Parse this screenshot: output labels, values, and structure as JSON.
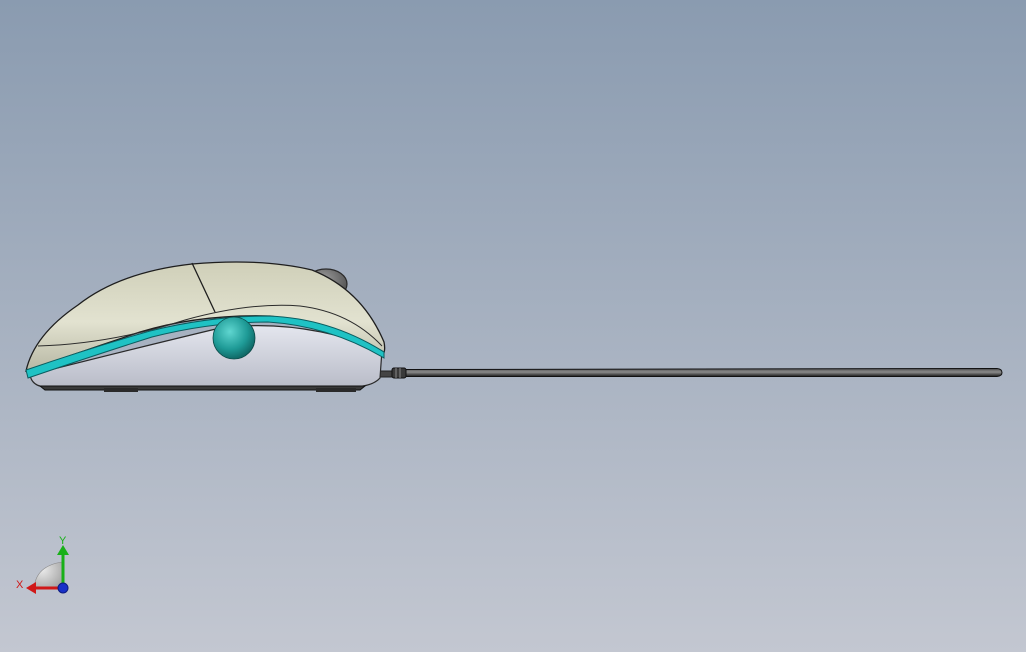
{
  "viewport": {
    "background_top": "#8a9bb0",
    "background_bottom": "#c3c7d1"
  },
  "model": {
    "name": "mouse",
    "body_color": "#d4d4c2",
    "accent_color": "#1fc2c4",
    "cable_color": "#2a2a2a",
    "wheel_color": "#6e6e6e"
  },
  "triad": {
    "x_label": "X",
    "y_label": "Y",
    "x_color": "#d01818",
    "y_color": "#18b018",
    "z_color": "#1830c8"
  }
}
